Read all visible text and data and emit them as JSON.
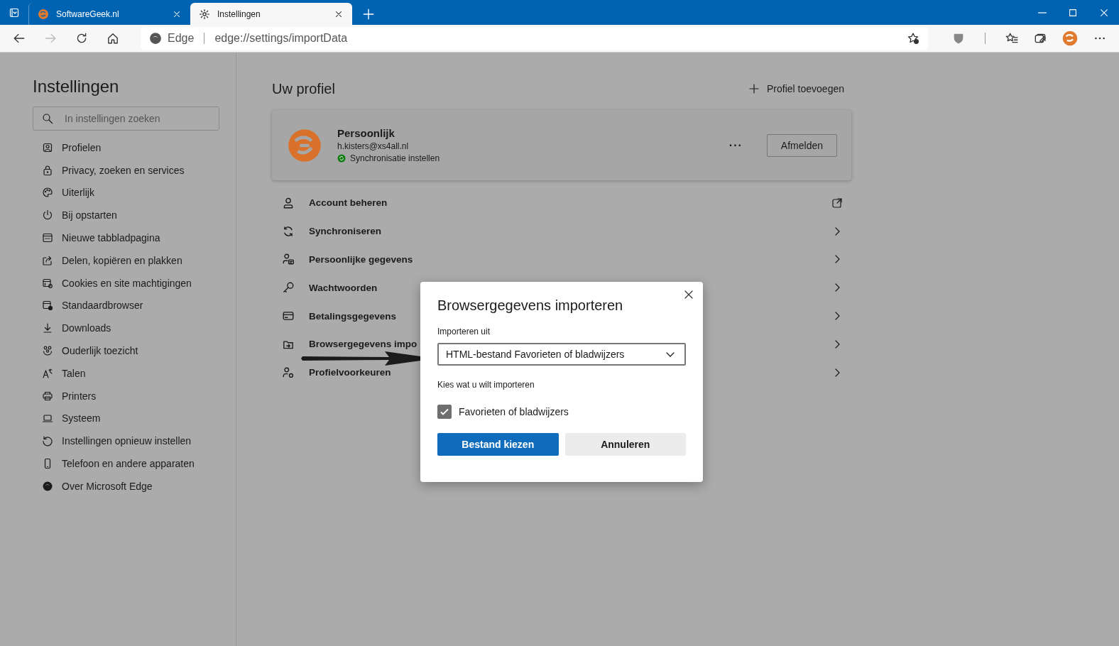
{
  "browser": {
    "tabs": [
      {
        "title": "SoftwareGeek.nl",
        "selected": false
      },
      {
        "title": "Instellingen",
        "selected": true
      }
    ],
    "address": {
      "site_label": "Edge",
      "url": "edge://settings/importData"
    }
  },
  "sidebar": {
    "title": "Instellingen",
    "search": {
      "placeholder": "In instellingen zoeken"
    },
    "items": [
      {
        "label": "Profielen",
        "selected": false
      },
      {
        "label": "Privacy, zoeken en services",
        "selected": false
      },
      {
        "label": "Uiterlijk",
        "selected": false
      },
      {
        "label": "Bij opstarten",
        "selected": false
      },
      {
        "label": "Nieuwe tabbladpagina",
        "selected": false
      },
      {
        "label": "Delen, kopiëren en plakken",
        "selected": false
      },
      {
        "label": "Cookies en site machtigingen",
        "selected": false
      },
      {
        "label": "Standaardbrowser",
        "selected": false
      },
      {
        "label": "Downloads",
        "selected": false
      },
      {
        "label": "Ouderlijk toezicht",
        "selected": false
      },
      {
        "label": "Talen",
        "selected": false
      },
      {
        "label": "Printers",
        "selected": false
      },
      {
        "label": "Systeem",
        "selected": false
      },
      {
        "label": "Instellingen opnieuw instellen",
        "selected": false
      },
      {
        "label": "Telefoon en andere apparaten",
        "selected": false
      },
      {
        "label": "Over Microsoft Edge",
        "selected": false
      }
    ]
  },
  "main": {
    "title": "Uw profiel",
    "add_profile": "Profiel toevoegen",
    "profile": {
      "name": "Persoonlijk",
      "email": "h.kisters@xs4all.nl",
      "sync_status": "Synchronisatie instellen",
      "more": "···",
      "sign_out": "Afmelden"
    },
    "rows": [
      {
        "label": "Account beheren",
        "kind": "external"
      },
      {
        "label": "Synchroniseren",
        "kind": "chevron"
      },
      {
        "label": "Persoonlijke gegevens",
        "kind": "chevron"
      },
      {
        "label": "Wachtwoorden",
        "kind": "chevron"
      },
      {
        "label": "Betalingsgegevens",
        "kind": "chevron"
      },
      {
        "label": "Browsergegevens impo",
        "kind": "chevron"
      },
      {
        "label": "Profielvoorkeuren",
        "kind": "chevron"
      }
    ]
  },
  "dialog": {
    "title": "Browsergegevens importeren",
    "source_label": "Importeren uit",
    "source_value": "HTML-bestand Favorieten of bladwijzers",
    "section_label": "Kies wat u wilt importeren",
    "options": [
      {
        "label": "Favorieten of bladwijzers",
        "checked": true
      }
    ],
    "buttons": [
      {
        "label": "Bestand kiezen",
        "kind": "primary"
      },
      {
        "label": "Annuleren",
        "kind": "secondary"
      }
    ]
  }
}
